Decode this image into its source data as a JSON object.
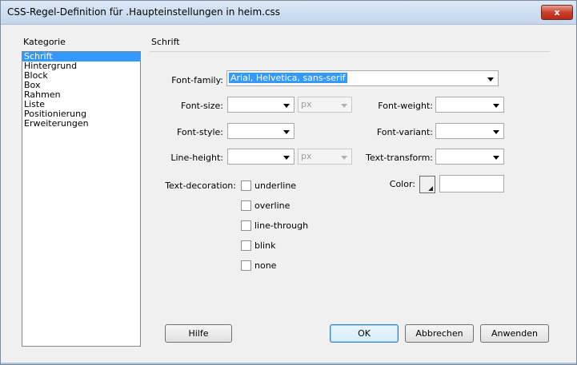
{
  "window": {
    "title": "CSS-Regel-Definition für .Haupteinstellungen in heim.css",
    "close_label": "x"
  },
  "category": {
    "label": "Kategorie",
    "items": [
      "Schrift",
      "Hintergrund",
      "Block",
      "Box",
      "Rahmen",
      "Liste",
      "Positionierung",
      "Erweiterungen"
    ],
    "selected": "Schrift"
  },
  "section": {
    "title": "Schrift"
  },
  "fields": {
    "font_family": {
      "label": "Font-family:",
      "value": "Arial, Helvetica, sans-serif"
    },
    "font_size": {
      "label": "Font-size:",
      "value": "",
      "unit": "px"
    },
    "font_weight": {
      "label": "Font-weight:",
      "value": ""
    },
    "font_style": {
      "label": "Font-style:",
      "value": ""
    },
    "font_variant": {
      "label": "Font-variant:",
      "value": ""
    },
    "line_height": {
      "label": "Line-height:",
      "value": "",
      "unit": "px"
    },
    "text_transform": {
      "label": "Text-transform:",
      "value": ""
    },
    "color": {
      "label": "Color:",
      "value": ""
    }
  },
  "text_decoration": {
    "label": "Text-decoration:",
    "options": [
      "underline",
      "overline",
      "line-through",
      "blink",
      "none"
    ]
  },
  "buttons": {
    "help": "Hilfe",
    "ok": "OK",
    "cancel": "Abbrechen",
    "apply": "Anwenden"
  }
}
